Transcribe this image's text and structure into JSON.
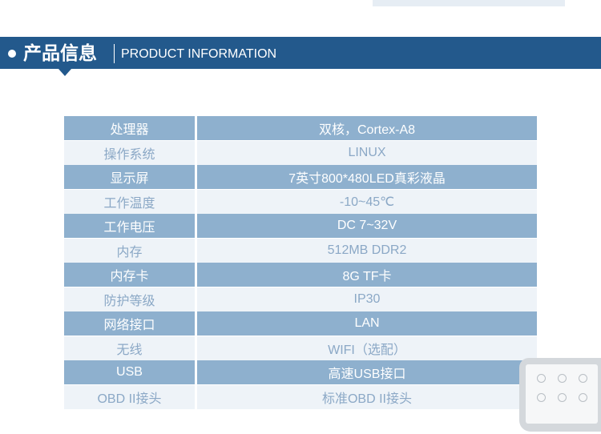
{
  "header": {
    "title_cn": "产品信息",
    "title_en": "PRODUCT INFORMATION"
  },
  "colors": {
    "banner": "#23598c",
    "row_dark": "#8eb0ce",
    "row_light": "#eef3f8",
    "light_text": "#8ba8c6"
  },
  "specs": [
    {
      "key": "处理器",
      "value": "双核，Cortex-A8"
    },
    {
      "key": "操作系统",
      "value": "LINUX"
    },
    {
      "key": "显示屏",
      "value": "7英寸800*480LED真彩液晶"
    },
    {
      "key": "工作温度",
      "value": "-10~45℃"
    },
    {
      "key": "工作电压",
      "value": "DC 7~32V"
    },
    {
      "key": "内存",
      "value": "512MB DDR2"
    },
    {
      "key": "内存卡",
      "value": "8G TF卡"
    },
    {
      "key": "防护等级",
      "value": "IP30"
    },
    {
      "key": "网络接口",
      "value": "LAN"
    },
    {
      "key": "无线",
      "value": "WIFI（选配）"
    },
    {
      "key": "USB",
      "value": "高速USB接口"
    },
    {
      "key": "OBD II接头",
      "value": "标准OBD II接头"
    }
  ]
}
